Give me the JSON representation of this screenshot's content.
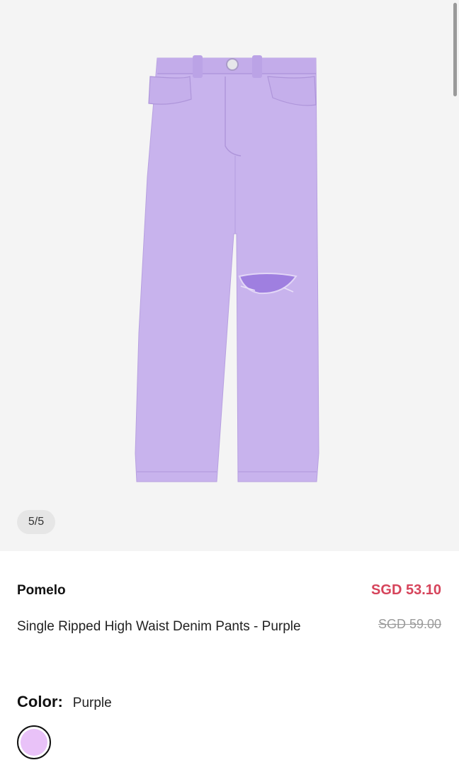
{
  "gallery": {
    "counter": "5/5",
    "image_alt": "Single Ripped High Waist Denim Pants - Purple product photo"
  },
  "product": {
    "brand": "Pomelo",
    "title": "Single Ripped High Waist Denim Pants - Purple",
    "price": "SGD 53.10",
    "original_price": "SGD 59.00",
    "color_label": "Color:",
    "color_value": "Purple"
  },
  "colors": {
    "price": "#d6445b",
    "swatch": "#e9c2f8",
    "pants": "#c8b3ed"
  }
}
